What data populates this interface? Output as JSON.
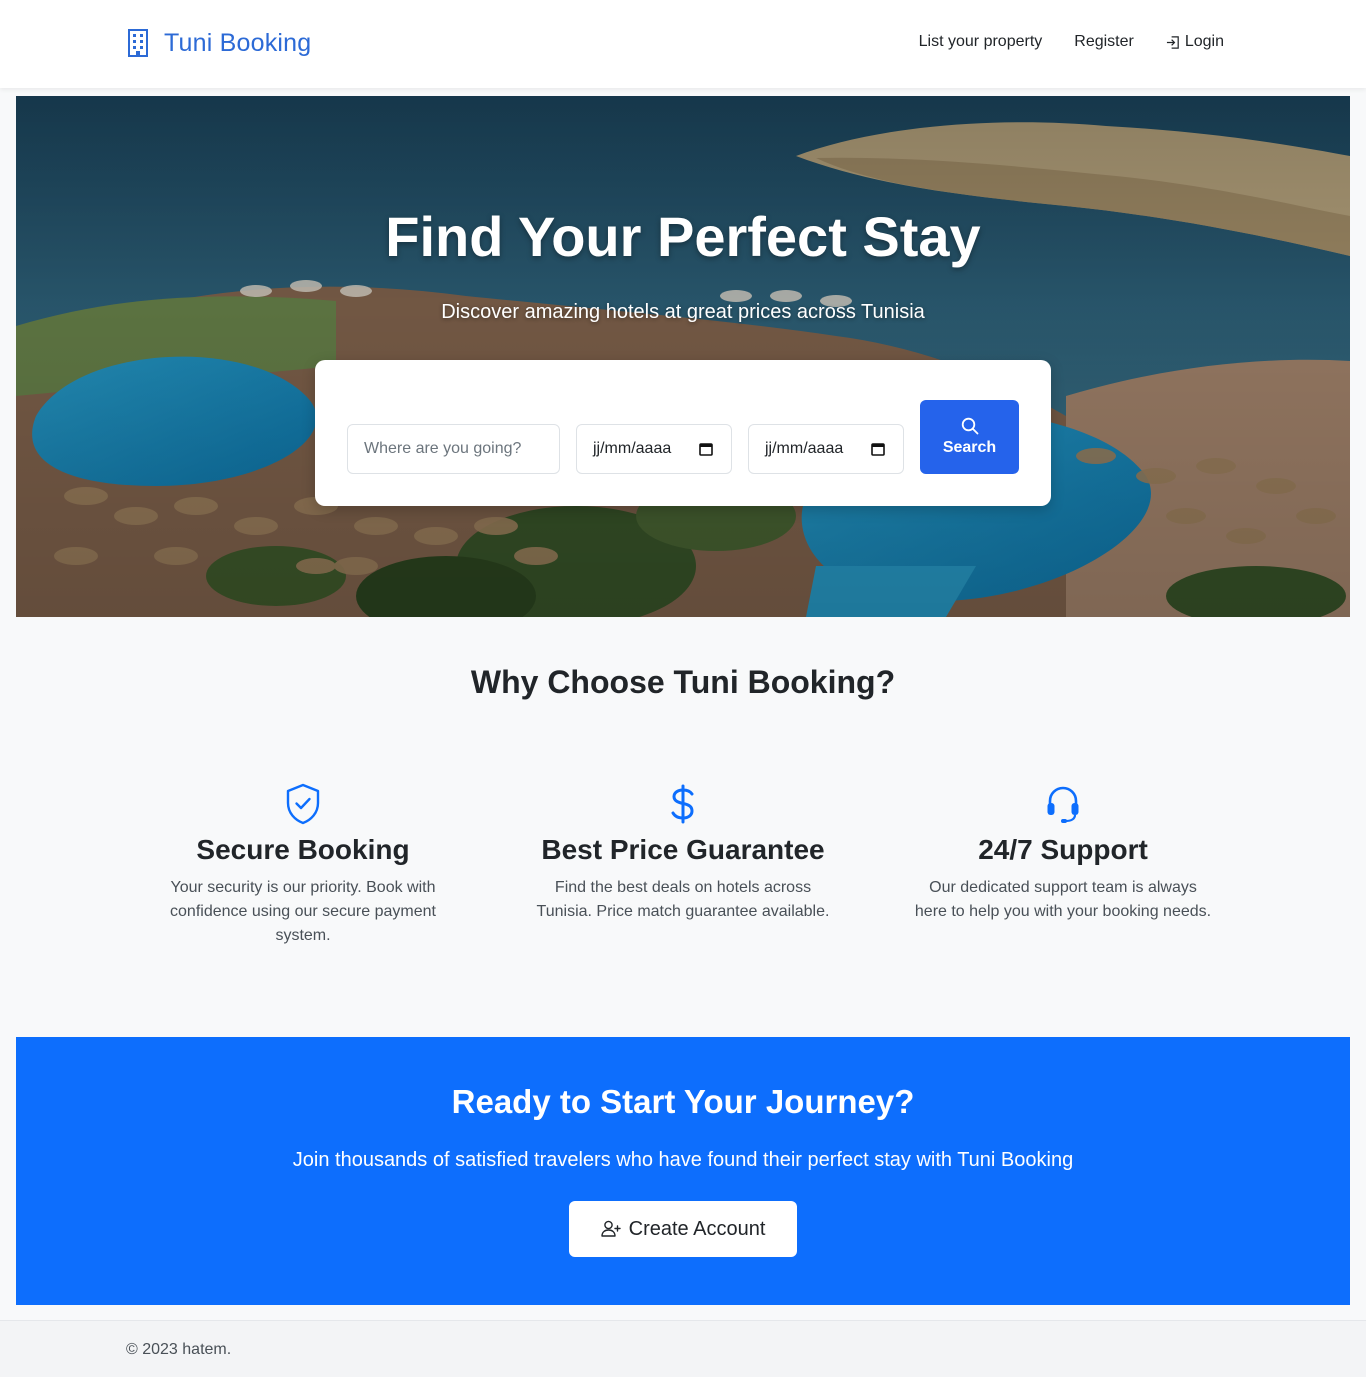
{
  "navbar": {
    "brand": "Tuni Booking",
    "links": {
      "list_property": "List your property",
      "register": "Register",
      "login": "Login"
    }
  },
  "hero": {
    "title": "Find Your Perfect Stay",
    "subtitle": "Discover amazing hotels at great prices across Tunisia",
    "search": {
      "destination_placeholder": "Where are you going?",
      "checkin_value": "jj/mm/aaaa",
      "checkout_value": "jj/mm/aaaa",
      "button_label": "Search"
    }
  },
  "features": {
    "title": "Why Choose Tuni Booking?",
    "items": [
      {
        "icon": "shield-check-icon",
        "title": "Secure Booking",
        "text": "Your security is our priority. Book with confidence using our secure payment system."
      },
      {
        "icon": "dollar-icon",
        "title": "Best Price Guarantee",
        "text": "Find the best deals on hotels across Tunisia. Price match guarantee available."
      },
      {
        "icon": "headset-icon",
        "title": "24/7 Support",
        "text": "Our dedicated support team is always here to help you with your booking needs."
      }
    ]
  },
  "cta": {
    "title": "Ready to Start Your Journey?",
    "text": "Join thousands of satisfied travelers who have found their perfect stay with Tuni Booking",
    "button_label": "Create Account"
  },
  "footer": {
    "copyright": "© 2023 hatem."
  },
  "colors": {
    "brand": "#2c6ad6",
    "primary_button": "#2563eb",
    "cta_background": "#0d6efd",
    "page_background": "#f8f9fa"
  }
}
